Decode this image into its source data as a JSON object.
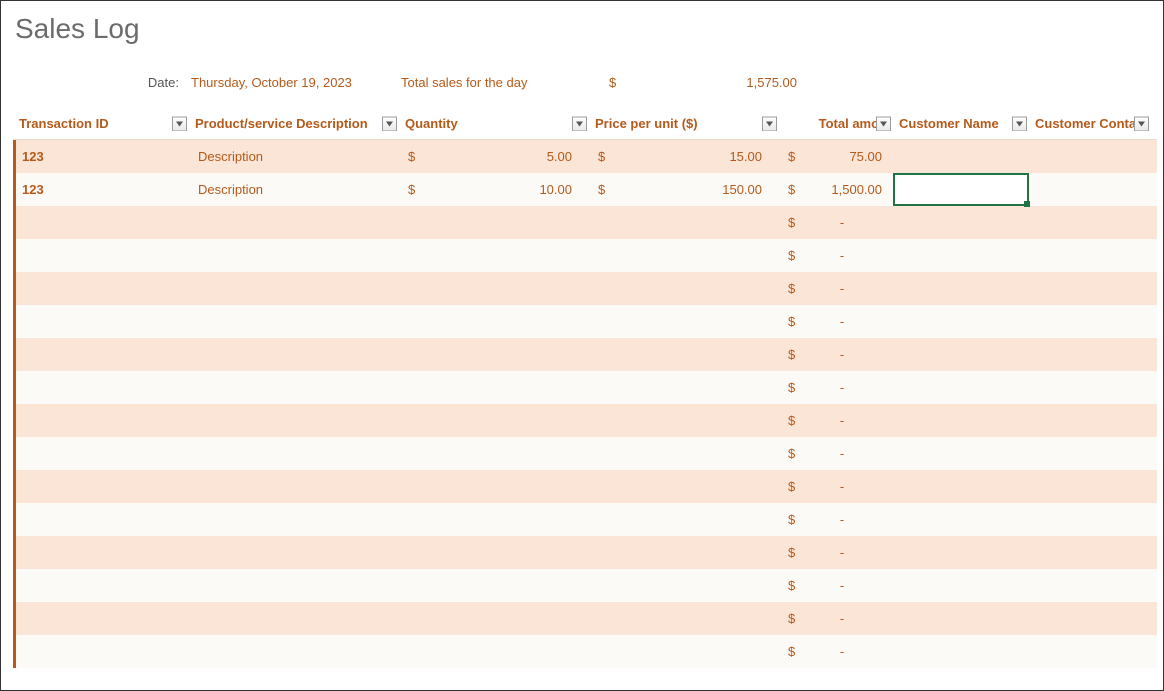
{
  "title": "Sales Log",
  "summary": {
    "date_label": "Date:",
    "date_value": "Thursday, October 19, 2023",
    "total_label": "Total sales for the day",
    "currency": "$",
    "total_value": "1,575.00"
  },
  "columns": {
    "transaction_id": "Transaction ID",
    "description": "Product/service Description",
    "quantity": "Quantity",
    "price": "Price per unit ($)",
    "amount": "Total amou",
    "customer_name": "Customer Name",
    "customer_contact": "Customer Contac"
  },
  "rows": [
    {
      "tid": "123",
      "desc": "Description",
      "qty": "5.00",
      "price": "15.00",
      "amt": "75.00",
      "name": "",
      "contact": ""
    },
    {
      "tid": "123",
      "desc": "Description",
      "qty": "10.00",
      "price": "150.00",
      "amt": "1,500.00",
      "name": "",
      "contact": ""
    },
    {
      "tid": "",
      "desc": "",
      "qty": "",
      "price": "",
      "amt": "-",
      "name": "",
      "contact": ""
    },
    {
      "tid": "",
      "desc": "",
      "qty": "",
      "price": "",
      "amt": "-",
      "name": "",
      "contact": ""
    },
    {
      "tid": "",
      "desc": "",
      "qty": "",
      "price": "",
      "amt": "-",
      "name": "",
      "contact": ""
    },
    {
      "tid": "",
      "desc": "",
      "qty": "",
      "price": "",
      "amt": "-",
      "name": "",
      "contact": ""
    },
    {
      "tid": "",
      "desc": "",
      "qty": "",
      "price": "",
      "amt": "-",
      "name": "",
      "contact": ""
    },
    {
      "tid": "",
      "desc": "",
      "qty": "",
      "price": "",
      "amt": "-",
      "name": "",
      "contact": ""
    },
    {
      "tid": "",
      "desc": "",
      "qty": "",
      "price": "",
      "amt": "-",
      "name": "",
      "contact": ""
    },
    {
      "tid": "",
      "desc": "",
      "qty": "",
      "price": "",
      "amt": "-",
      "name": "",
      "contact": ""
    },
    {
      "tid": "",
      "desc": "",
      "qty": "",
      "price": "",
      "amt": "-",
      "name": "",
      "contact": ""
    },
    {
      "tid": "",
      "desc": "",
      "qty": "",
      "price": "",
      "amt": "-",
      "name": "",
      "contact": ""
    },
    {
      "tid": "",
      "desc": "",
      "qty": "",
      "price": "",
      "amt": "-",
      "name": "",
      "contact": ""
    },
    {
      "tid": "",
      "desc": "",
      "qty": "",
      "price": "",
      "amt": "-",
      "name": "",
      "contact": ""
    },
    {
      "tid": "",
      "desc": "",
      "qty": "",
      "price": "",
      "amt": "-",
      "name": "",
      "contact": ""
    },
    {
      "tid": "",
      "desc": "",
      "qty": "",
      "price": "",
      "amt": "-",
      "name": "",
      "contact": ""
    }
  ],
  "currency_symbol": "$"
}
